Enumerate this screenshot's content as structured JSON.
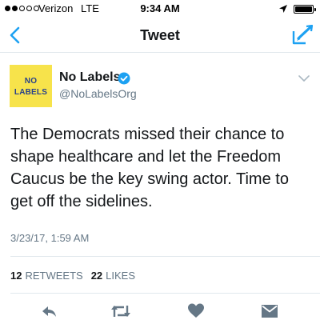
{
  "status_bar": {
    "carrier": "Verizon",
    "network": "LTE",
    "time": "9:34 AM",
    "signal_bars_filled": 2,
    "signal_bars_total": 5,
    "battery_level": 1.0,
    "icons": [
      "signal-dots-icon",
      "location-arrow-icon",
      "battery-icon"
    ]
  },
  "nav": {
    "title": "Tweet",
    "back_icon": "chevron-left-icon",
    "compose_icon": "compose-tweet-icon"
  },
  "tweet": {
    "avatar": {
      "line1": "NO",
      "line2": "LABELS"
    },
    "display_name": "No Labels",
    "handle": "@NoLabelsOrg",
    "verified": true,
    "text": "The Democrats missed their chance to shape healthcare and let the Freedom Caucus be the key swing actor. Time to get off the sidelines.",
    "timestamp": "3/23/17, 1:59 AM",
    "stats": {
      "retweets_count": "12",
      "retweets_label": "RETWEETS",
      "likes_count": "22",
      "likes_label": "LIKES"
    }
  },
  "actions": [
    "reply-icon",
    "retweet-icon",
    "like-icon",
    "direct-message-icon"
  ],
  "colors": {
    "accent": "#1da1f2",
    "text": "#14171a",
    "secondary_text": "#657786",
    "action_icon": "#657786",
    "divider": "#e1e8ed",
    "avatar_bg": "#f7e34b",
    "avatar_text": "#27408b"
  }
}
